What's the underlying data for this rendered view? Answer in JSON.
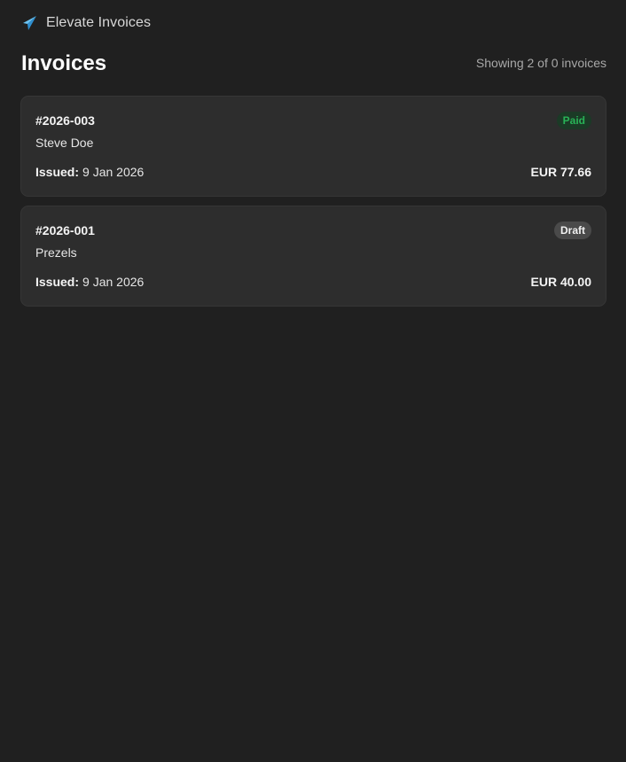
{
  "app": {
    "brand_name": "Elevate Invoices",
    "brand_icon": "paper-plane-icon",
    "accent_color": "#4fb3ea"
  },
  "header": {
    "title": "Invoices",
    "count_text": "Showing 2 of 0 invoices"
  },
  "invoices": [
    {
      "number": "#2026-003",
      "client": "Steve Doe",
      "issued_label": "Issued:",
      "issued_date": "9 Jan 2026",
      "amount": "EUR 77.66",
      "status": "Paid",
      "status_color": "#29b357"
    },
    {
      "number": "#2026-001",
      "client": "Prezels",
      "issued_label": "Issued:",
      "issued_date": "9 Jan 2026",
      "amount": "EUR 40.00",
      "status": "Draft",
      "status_color": "#f0f0f0"
    }
  ]
}
